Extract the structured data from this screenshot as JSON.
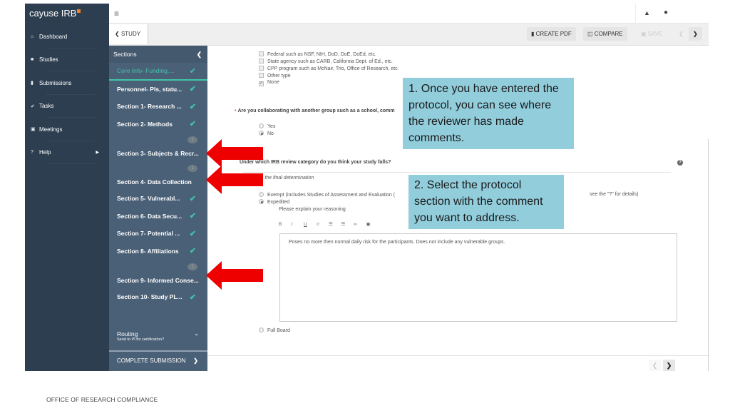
{
  "app": {
    "brand": "cayuse IRB",
    "brand_accent_color": "#f0812a"
  },
  "nav": {
    "items": [
      {
        "label": "Dashboard",
        "icon": "home-icon"
      },
      {
        "label": "Studies",
        "icon": "folder-icon"
      },
      {
        "label": "Submissions",
        "icon": "file-icon"
      },
      {
        "label": "Tasks",
        "icon": "check-icon"
      },
      {
        "label": "Meetings",
        "icon": "calendar-icon"
      },
      {
        "label": "Help",
        "icon": "question-icon",
        "has_submenu": true
      }
    ]
  },
  "topbar": {
    "menu_icon": "hamburger-icon",
    "notifications_icon": "bell-icon",
    "user_icon": "user-icon"
  },
  "toolbar": {
    "back_label": "STUDY",
    "create_pdf_label": "CREATE PDF",
    "compare_label": "COMPARE",
    "save_label": "SAVE"
  },
  "sections": {
    "header": "Sections",
    "items": [
      {
        "label": "Core Info- Funding,...",
        "complete": true,
        "active": true
      },
      {
        "label": "Personnel- PIs, statu...",
        "complete": true
      },
      {
        "label": "Section 1- Research ...",
        "complete": true
      },
      {
        "label": "Section 2- Methods",
        "complete": true
      },
      {
        "label": "Section 3- Subjects & Recr...",
        "complete": false,
        "comments": 1
      },
      {
        "label": "Section 4- Data Collection",
        "complete": false,
        "comments": 1
      },
      {
        "label": "Section 5- Vulnerabl...",
        "complete": true
      },
      {
        "label": "Section 6- Data Secu...",
        "complete": true
      },
      {
        "label": "Section 7- Potential ...",
        "complete": true
      },
      {
        "label": "Section 8- Affiliations",
        "complete": true
      },
      {
        "label": "Section 9- Informed Conse...",
        "complete": false,
        "comments": 1
      },
      {
        "label": "Section 10- Study PL...",
        "complete": true
      }
    ],
    "routing_title": "Routing",
    "routing_subtitle": "Send to PI for certification?",
    "complete_submission": "COMPLETE SUBMISSION"
  },
  "form": {
    "funding_options": [
      {
        "label": "Federal such as NSF, NIH, DoD, DoE, DoEd, etc.",
        "checked": false
      },
      {
        "label": "State agency such as CARB, California Dept. of Ed., etc.",
        "checked": false
      },
      {
        "label": "CPP program such as McNair, Trio, Office of Research, etc.",
        "checked": false
      },
      {
        "label": "Other type",
        "checked": false
      },
      {
        "label": "None",
        "checked": true
      }
    ],
    "collab_question": "Are you collaborating with another group such as a school, comm",
    "collab_options": [
      {
        "label": "Yes",
        "selected": false
      },
      {
        "label": "No",
        "selected": true
      }
    ],
    "category_question": "Under which IRB review category do you think your study falls?",
    "category_note": "The IRB will make the final determination",
    "category_options": [
      {
        "label": "Exempt (includes Studies of Assessment and Evaluation (",
        "selected": false
      },
      {
        "label": "Expedited",
        "selected": true
      },
      {
        "label": "Full Board",
        "selected": false
      }
    ],
    "exempt_suffix": "see the \"?\" for details)",
    "reasoning_label": "Please explain your reasoning",
    "editor_tools": [
      "B",
      "I",
      "U",
      "S",
      "ul",
      "ol",
      "link",
      "image"
    ],
    "reasoning_text": "Poses no more then normal daily risk for the participants. Does not include any vulnerable groups."
  },
  "callouts": {
    "one": "1. Once you have entered the protocol, you can see where the reviewer has made comments.",
    "two": "2. Select the protocol section with the comment you want to address."
  },
  "annotation_color": "#ee0000",
  "callout_color": "#92cddc",
  "footer": "OFFICE OF RESEARCH COMPLIANCE"
}
